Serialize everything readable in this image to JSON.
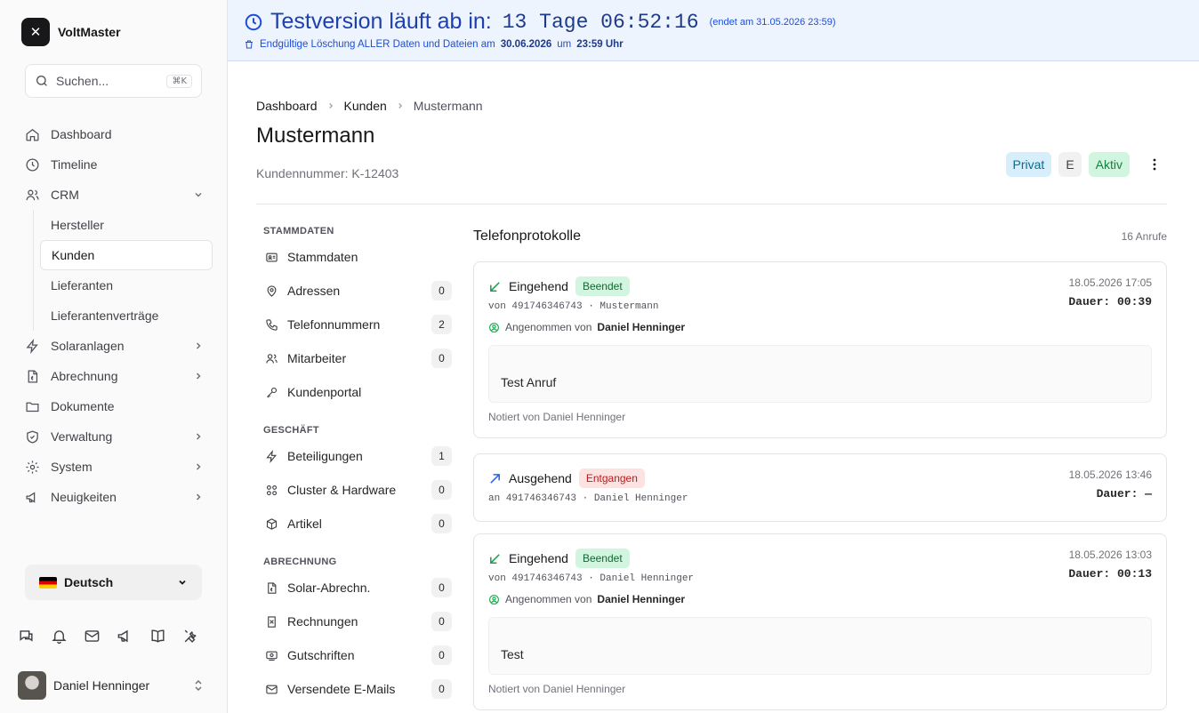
{
  "brand": {
    "name": "VoltMaster"
  },
  "search": {
    "placeholder": "Suchen...",
    "shortcut": "⌘K"
  },
  "sidebar": {
    "items": [
      {
        "label": "Dashboard",
        "icon": "home-icon"
      },
      {
        "label": "Timeline",
        "icon": "clock-icon"
      },
      {
        "label": "CRM",
        "icon": "users-icon",
        "expanded": true,
        "children": [
          "Hersteller",
          "Kunden",
          "Lieferanten",
          "Lieferantenverträge"
        ],
        "active_child": "Kunden"
      },
      {
        "label": "Solaranlagen",
        "icon": "bolt-icon"
      },
      {
        "label": "Abrechnung",
        "icon": "invoice-icon"
      },
      {
        "label": "Dokumente",
        "icon": "folder-icon"
      },
      {
        "label": "Verwaltung",
        "icon": "shield-icon"
      },
      {
        "label": "System",
        "icon": "gear-icon"
      },
      {
        "label": "Neuigkeiten",
        "icon": "megaphone-icon"
      }
    ]
  },
  "language": {
    "selected": "Deutsch"
  },
  "user": {
    "name": "Daniel Henninger"
  },
  "banner": {
    "title": "Testversion läuft ab in:",
    "timer": "13 Tage 06:52:16",
    "ends": "(endet am 31.05.2026 23:59)",
    "deletion_prefix": "Endgültige Löschung ALLER Daten und Dateien am",
    "deletion_date": "30.06.2026",
    "deletion_mid": "um",
    "deletion_time": "23:59 Uhr"
  },
  "breadcrumb": [
    "Dashboard",
    "Kunden",
    "Mustermann"
  ],
  "customer": {
    "name": "Mustermann",
    "number": "Kundennummer: K-12403",
    "badges": {
      "type": "Privat",
      "letter": "E",
      "status": "Aktiv"
    },
    "colors": {
      "privat": "#d6effb",
      "aktiv": "#d1f5de"
    }
  },
  "sections": {
    "stammdaten": {
      "heading": "STAMMDATEN",
      "items": [
        {
          "label": "Stammdaten",
          "count": null
        },
        {
          "label": "Adressen",
          "count": "0"
        },
        {
          "label": "Telefonnummern",
          "count": "2"
        },
        {
          "label": "Mitarbeiter",
          "count": "0"
        },
        {
          "label": "Kundenportal",
          "count": null
        }
      ]
    },
    "geschaeft": {
      "heading": "GESCHÄFT",
      "items": [
        {
          "label": "Beteiligungen",
          "count": "1"
        },
        {
          "label": "Cluster & Hardware",
          "count": "0"
        },
        {
          "label": "Artikel",
          "count": "0"
        }
      ]
    },
    "abrechnung": {
      "heading": "ABRECHNUNG",
      "items": [
        {
          "label": "Solar-Abrechn.",
          "count": "0"
        },
        {
          "label": "Rechnungen",
          "count": "0"
        },
        {
          "label": "Gutschriften",
          "count": "0"
        },
        {
          "label": "Versendete E-Mails",
          "count": "0"
        }
      ]
    }
  },
  "calls": {
    "title": "Telefonprotokolle",
    "count": "16 Anrufe",
    "items": [
      {
        "direction": "Eingehend",
        "status": "Beendet",
        "meta": "von 491746346743 · Mustermann",
        "accepted_prefix": "Angenommen von",
        "accepted_by": "Daniel Henninger",
        "date": "18.05.2026 17:05",
        "duration": "Dauer: 00:39",
        "note": "Test Anruf",
        "noted_by": "Notiert von Daniel Henninger"
      },
      {
        "direction": "Ausgehend",
        "status": "Entgangen",
        "meta": "an 491746346743 · Daniel Henninger",
        "date": "18.05.2026 13:46",
        "duration": "Dauer: —"
      },
      {
        "direction": "Eingehend",
        "status": "Beendet",
        "meta": "von 491746346743 · Daniel Henninger",
        "accepted_prefix": "Angenommen von",
        "accepted_by": "Daniel Henninger",
        "date": "18.05.2026 13:03",
        "duration": "Dauer: 00:13",
        "note": "Test",
        "noted_by": "Notiert von Daniel Henninger"
      }
    ]
  }
}
